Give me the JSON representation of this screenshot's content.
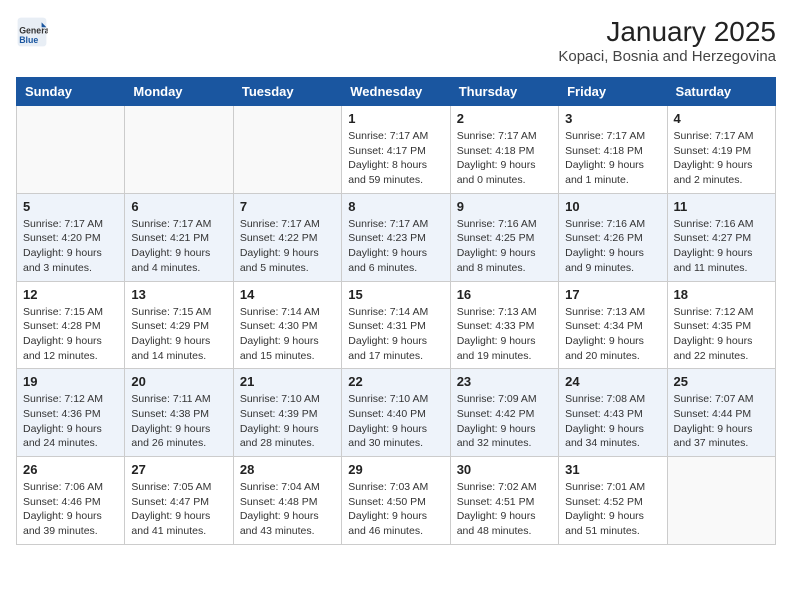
{
  "header": {
    "logo": {
      "general": "General",
      "blue": "Blue"
    },
    "title": "January 2025",
    "subtitle": "Kopaci, Bosnia and Herzegovina"
  },
  "days_of_week": [
    "Sunday",
    "Monday",
    "Tuesday",
    "Wednesday",
    "Thursday",
    "Friday",
    "Saturday"
  ],
  "weeks": [
    [
      {
        "day": "",
        "info": ""
      },
      {
        "day": "",
        "info": ""
      },
      {
        "day": "",
        "info": ""
      },
      {
        "day": "1",
        "info": "Sunrise: 7:17 AM\nSunset: 4:17 PM\nDaylight: 8 hours and 59 minutes."
      },
      {
        "day": "2",
        "info": "Sunrise: 7:17 AM\nSunset: 4:18 PM\nDaylight: 9 hours and 0 minutes."
      },
      {
        "day": "3",
        "info": "Sunrise: 7:17 AM\nSunset: 4:18 PM\nDaylight: 9 hours and 1 minute."
      },
      {
        "day": "4",
        "info": "Sunrise: 7:17 AM\nSunset: 4:19 PM\nDaylight: 9 hours and 2 minutes."
      }
    ],
    [
      {
        "day": "5",
        "info": "Sunrise: 7:17 AM\nSunset: 4:20 PM\nDaylight: 9 hours and 3 minutes."
      },
      {
        "day": "6",
        "info": "Sunrise: 7:17 AM\nSunset: 4:21 PM\nDaylight: 9 hours and 4 minutes."
      },
      {
        "day": "7",
        "info": "Sunrise: 7:17 AM\nSunset: 4:22 PM\nDaylight: 9 hours and 5 minutes."
      },
      {
        "day": "8",
        "info": "Sunrise: 7:17 AM\nSunset: 4:23 PM\nDaylight: 9 hours and 6 minutes."
      },
      {
        "day": "9",
        "info": "Sunrise: 7:16 AM\nSunset: 4:25 PM\nDaylight: 9 hours and 8 minutes."
      },
      {
        "day": "10",
        "info": "Sunrise: 7:16 AM\nSunset: 4:26 PM\nDaylight: 9 hours and 9 minutes."
      },
      {
        "day": "11",
        "info": "Sunrise: 7:16 AM\nSunset: 4:27 PM\nDaylight: 9 hours and 11 minutes."
      }
    ],
    [
      {
        "day": "12",
        "info": "Sunrise: 7:15 AM\nSunset: 4:28 PM\nDaylight: 9 hours and 12 minutes."
      },
      {
        "day": "13",
        "info": "Sunrise: 7:15 AM\nSunset: 4:29 PM\nDaylight: 9 hours and 14 minutes."
      },
      {
        "day": "14",
        "info": "Sunrise: 7:14 AM\nSunset: 4:30 PM\nDaylight: 9 hours and 15 minutes."
      },
      {
        "day": "15",
        "info": "Sunrise: 7:14 AM\nSunset: 4:31 PM\nDaylight: 9 hours and 17 minutes."
      },
      {
        "day": "16",
        "info": "Sunrise: 7:13 AM\nSunset: 4:33 PM\nDaylight: 9 hours and 19 minutes."
      },
      {
        "day": "17",
        "info": "Sunrise: 7:13 AM\nSunset: 4:34 PM\nDaylight: 9 hours and 20 minutes."
      },
      {
        "day": "18",
        "info": "Sunrise: 7:12 AM\nSunset: 4:35 PM\nDaylight: 9 hours and 22 minutes."
      }
    ],
    [
      {
        "day": "19",
        "info": "Sunrise: 7:12 AM\nSunset: 4:36 PM\nDaylight: 9 hours and 24 minutes."
      },
      {
        "day": "20",
        "info": "Sunrise: 7:11 AM\nSunset: 4:38 PM\nDaylight: 9 hours and 26 minutes."
      },
      {
        "day": "21",
        "info": "Sunrise: 7:10 AM\nSunset: 4:39 PM\nDaylight: 9 hours and 28 minutes."
      },
      {
        "day": "22",
        "info": "Sunrise: 7:10 AM\nSunset: 4:40 PM\nDaylight: 9 hours and 30 minutes."
      },
      {
        "day": "23",
        "info": "Sunrise: 7:09 AM\nSunset: 4:42 PM\nDaylight: 9 hours and 32 minutes."
      },
      {
        "day": "24",
        "info": "Sunrise: 7:08 AM\nSunset: 4:43 PM\nDaylight: 9 hours and 34 minutes."
      },
      {
        "day": "25",
        "info": "Sunrise: 7:07 AM\nSunset: 4:44 PM\nDaylight: 9 hours and 37 minutes."
      }
    ],
    [
      {
        "day": "26",
        "info": "Sunrise: 7:06 AM\nSunset: 4:46 PM\nDaylight: 9 hours and 39 minutes."
      },
      {
        "day": "27",
        "info": "Sunrise: 7:05 AM\nSunset: 4:47 PM\nDaylight: 9 hours and 41 minutes."
      },
      {
        "day": "28",
        "info": "Sunrise: 7:04 AM\nSunset: 4:48 PM\nDaylight: 9 hours and 43 minutes."
      },
      {
        "day": "29",
        "info": "Sunrise: 7:03 AM\nSunset: 4:50 PM\nDaylight: 9 hours and 46 minutes."
      },
      {
        "day": "30",
        "info": "Sunrise: 7:02 AM\nSunset: 4:51 PM\nDaylight: 9 hours and 48 minutes."
      },
      {
        "day": "31",
        "info": "Sunrise: 7:01 AM\nSunset: 4:52 PM\nDaylight: 9 hours and 51 minutes."
      },
      {
        "day": "",
        "info": ""
      }
    ]
  ]
}
